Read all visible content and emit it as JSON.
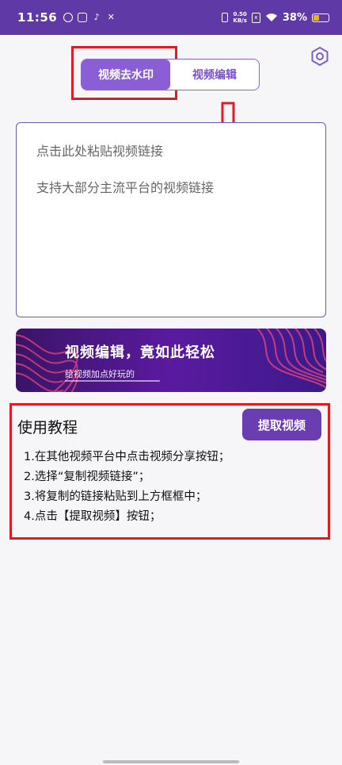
{
  "status_bar": {
    "time": "11:56",
    "speed_value": "0.50",
    "speed_unit": "KB/s",
    "sim_label": "x",
    "battery": "38%"
  },
  "tabs": [
    {
      "label": "视频去水印",
      "active": true
    },
    {
      "label": "视频编辑",
      "active": false
    }
  ],
  "input": {
    "placeholder_line1": "点击此处粘贴视频链接",
    "placeholder_line2": "支持大部分主流平台的视频链接"
  },
  "banner": {
    "title": "视频编辑，竟如此轻松",
    "subtitle": "给视频加点好玩的"
  },
  "tutorial": {
    "title": "使用教程",
    "extract_button": "提取视频",
    "steps": [
      "1.在其他视频平台中点击视频分享按钮；",
      "2.选择“复制视频链接”；",
      "3.将复制的链接粘贴到上方框框中；",
      "4.点击【提取视频】按钮；"
    ]
  },
  "colors": {
    "status_bar": "#5f3aa6",
    "accent": "#8a5fd6",
    "button": "#6a3db0",
    "annotation_red": "#e01b24"
  },
  "icons": [
    "settings-icon",
    "wifi-icon",
    "battery-icon",
    "vibrate-icon",
    "arrow-down-icon"
  ]
}
